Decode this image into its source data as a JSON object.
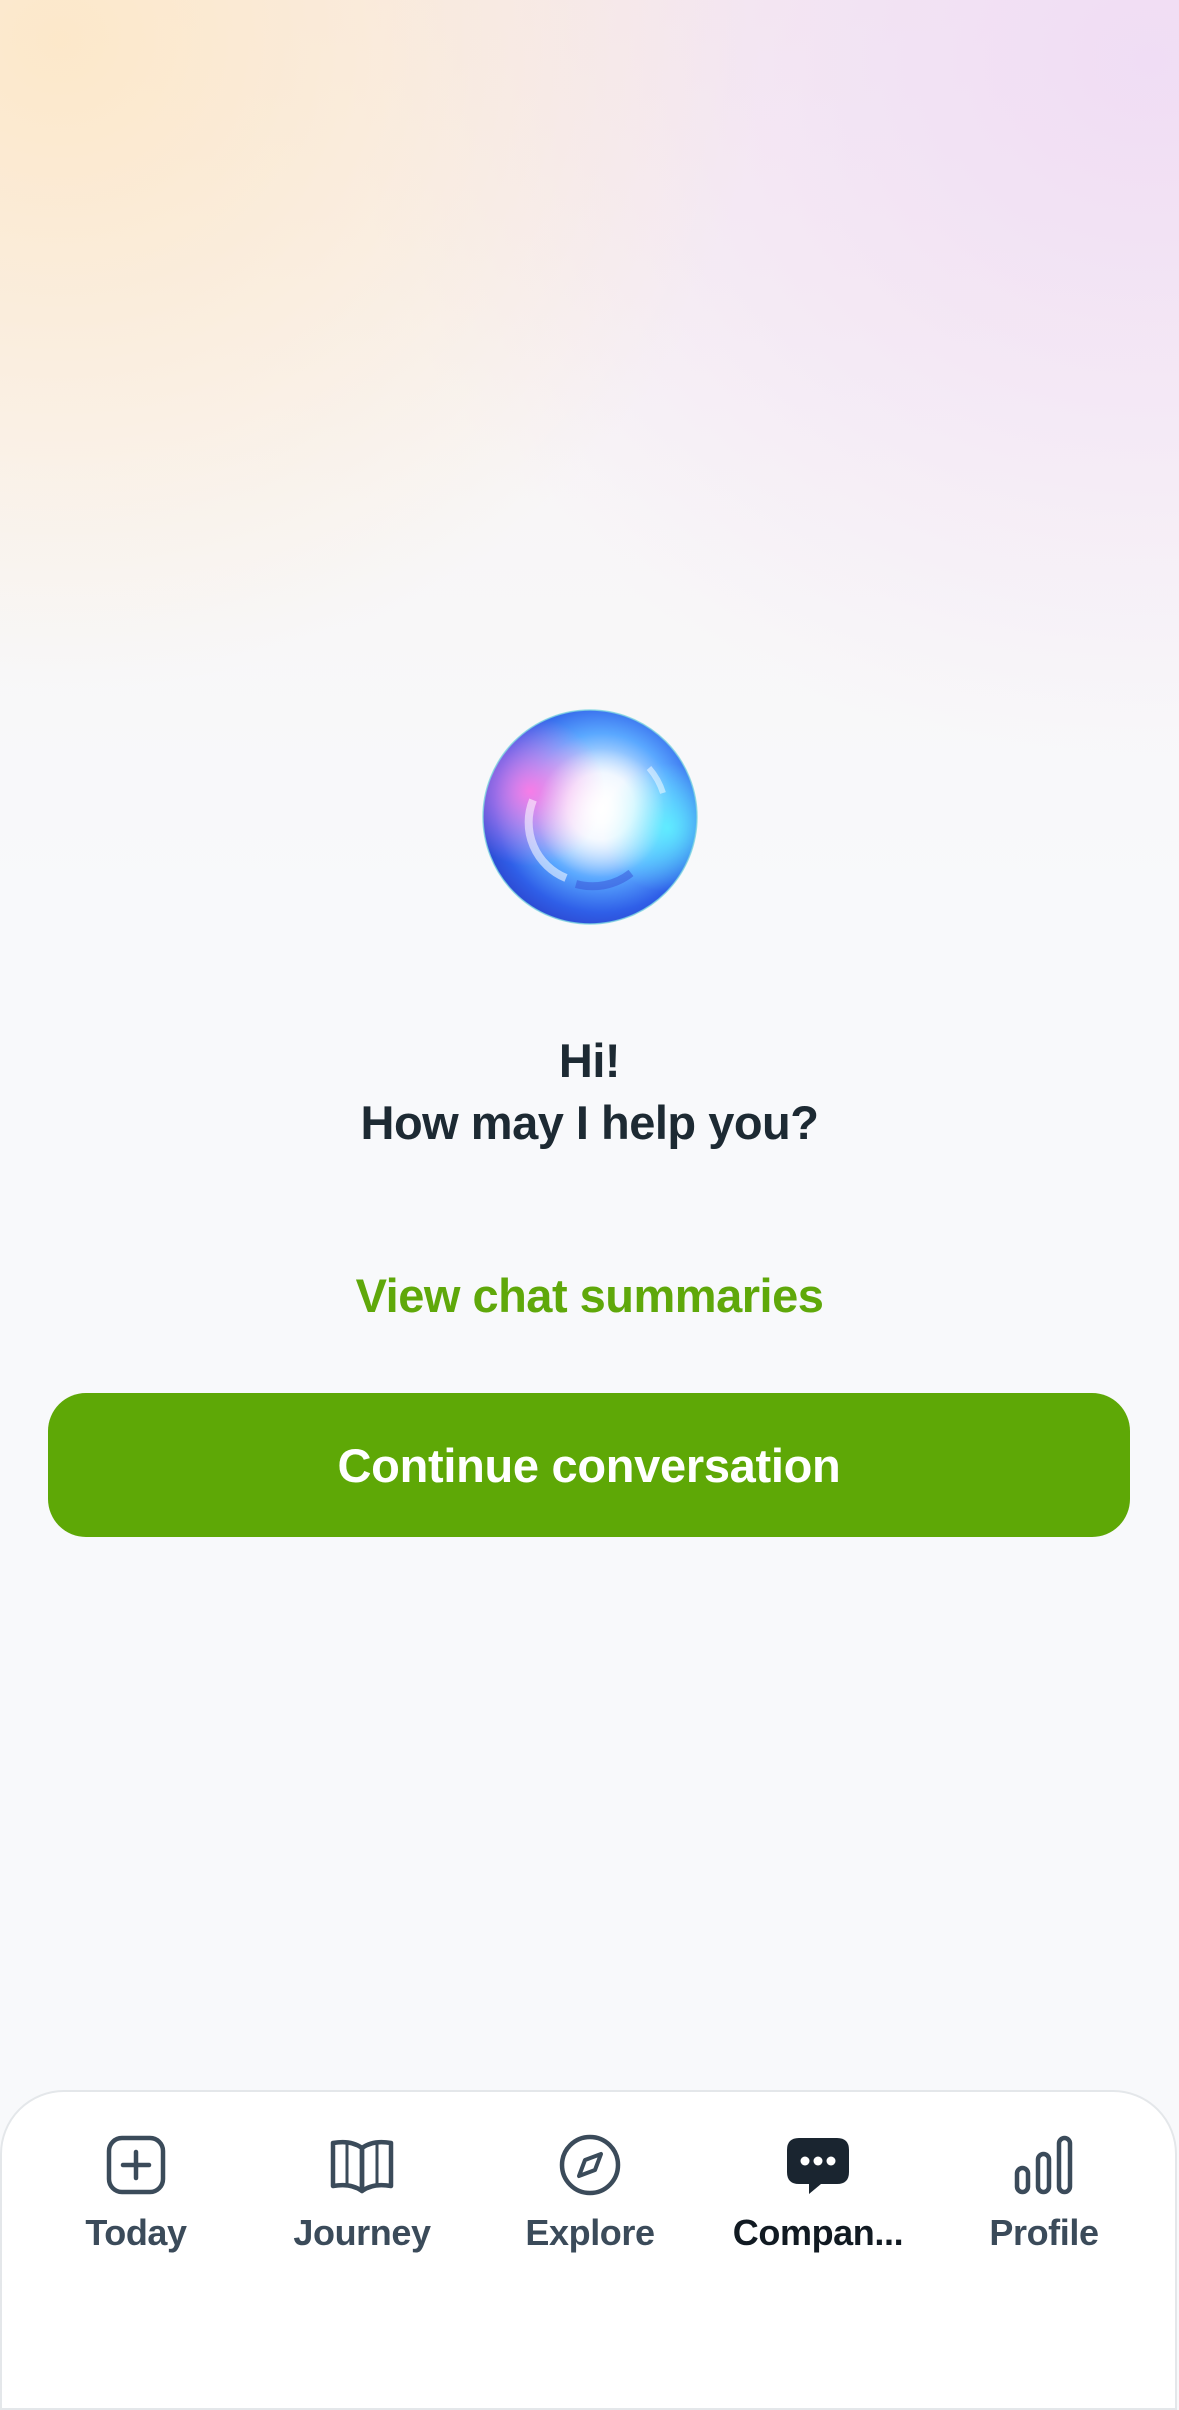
{
  "greeting": {
    "line1": "Hi!",
    "line2": "How may I help you?"
  },
  "actions": {
    "view_summaries_label": "View chat summaries",
    "continue_label": "Continue conversation"
  },
  "colors": {
    "accent_green": "#5ea806",
    "text_dark": "#1d2a33",
    "tab_icon": "#3b4b5a"
  },
  "tabbar": {
    "active": "companion",
    "items": [
      {
        "id": "today",
        "label": "Today",
        "icon": "plus-square-icon"
      },
      {
        "id": "journey",
        "label": "Journey",
        "icon": "open-book-icon"
      },
      {
        "id": "explore",
        "label": "Explore",
        "icon": "compass-icon"
      },
      {
        "id": "companion",
        "label": "Compan...",
        "icon": "chat-bubble-icon"
      },
      {
        "id": "profile",
        "label": "Profile",
        "icon": "bar-chart-icon"
      }
    ]
  }
}
